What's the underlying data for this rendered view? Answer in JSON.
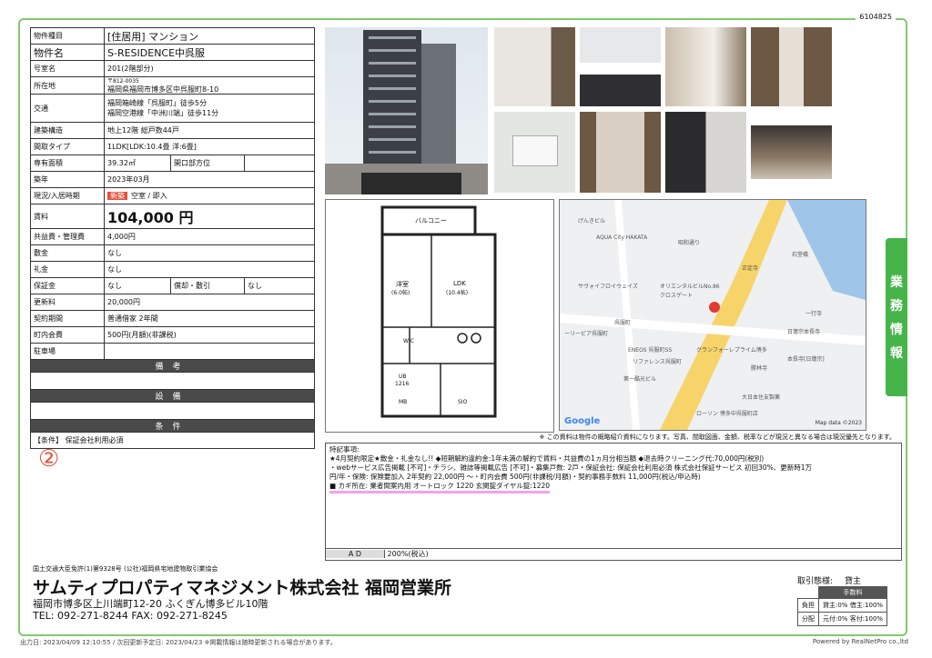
{
  "doc_id": "6104825",
  "info": {
    "type_k": "物件種目",
    "type_v": "[住居用] マンション",
    "name_k": "物件名",
    "name_v": "S-RESIDENCE中呉服",
    "room_k": "号室名",
    "room_v": "201(2階部分)",
    "addr_k": "所在地",
    "zip": "〒812-0035",
    "addr_v": "福岡県福岡市博多区中呉服町8-10",
    "traffic_k": "交通",
    "traffic1": "福岡箱崎線「呉服町」徒歩5分",
    "traffic2": "福岡空港線「中洲川端」徒歩11分",
    "struct_k": "建築構造",
    "struct_v": "地上12階 総戸数44戸",
    "layout_k": "間取タイプ",
    "layout_v": "1LDK[LDK:10.4畳 洋:6畳]",
    "area_k": "専有面積",
    "area_v": "39.32㎡",
    "open_k": "開口部方位",
    "open_v": "",
    "built_k": "築年",
    "built_v": "2023年03月",
    "status_k": "現況/入居時期",
    "status_badge": "新築",
    "status_v": "空室 / 即入",
    "rent_k": "賃料",
    "rent_v": "104,000 円",
    "fee_k": "共益費・管理費",
    "fee_v": "4,000円",
    "deposit_k": "敷金",
    "deposit_v": "なし",
    "key_k": "礼金",
    "key_v": "なし",
    "guar_k": "保証金",
    "guar_v": "なし",
    "amort_k": "償却・敷引",
    "amort_v": "なし",
    "renew_k": "更新料",
    "renew_v": "20,000円",
    "contract_k": "契約期間",
    "contract_v": "普通借家 2年間",
    "town_k": "町内会費",
    "town_v": "500円(月額)(非課税)",
    "parking_k": "駐車場",
    "parking_v": "",
    "remarks_h": "備考",
    "equip_h": "設備",
    "cond_h": "条件",
    "cond_v": "【条件】 保証会社利用必須"
  },
  "floorplan": {
    "balcony": "バルコニー",
    "western": "洋室",
    "western_size": "(6.0帖)",
    "ldk": "LDK",
    "ldk_size": "(10.4帖)",
    "wic": "WIC",
    "ub": "UB",
    "ub_size": "1216",
    "sio": "SIO",
    "mb": "MB"
  },
  "map": {
    "labels": [
      "げんきビル",
      "AQUA City HAKATA",
      "昭和通り",
      "正定寺",
      "石堂橋",
      "サヴォイフロイウェイズ",
      "オリエンタルビルNo.86",
      "クロスゲート",
      "呉服町",
      "一行寺",
      "ーリービア呉服町",
      "ENEOS 呉服町SS",
      "グランフォーレプライム博多",
      "本長寺[日蓮宗]",
      "リファレンス呉服町",
      "勝林寺",
      "第一酷光ビル",
      "大日本住友製薬",
      "ローソン 博多中呉服町店",
      "日蓮宗本長寺"
    ],
    "google": "Google",
    "credit": "Map data ©2023"
  },
  "note_disclaimer": "※ この資料は物件の概略紹介資料になります。写真、間取図面、金額、税率などが現況と異なる場合は現況優先となります。",
  "notes": {
    "title": "特記事項:",
    "line1": "★4月契約限定★敷金・礼金なし!! ◆短期解約違約金:1年未満の解約で賃料・共益費の1ヵ月分相当額 ◆退去時クリーニング代:70,000円(税別)",
    "line2": "・webサービス広告掲載 [不可]・チラシ、雑誌等掲載広告 [不可]・募集戸数: 2戸・保証会社: 保証会社利用必須 株式会社保証サービス 初回30%、更新時1万",
    "line3": "円/年・保険: 保険要加入 2年契約 22,000円 ～・町内会費 500円(非課税/月額)・契約事務手数料 11,000円(税込/申込時)",
    "line4": "■ カギ所在: 業者間案内用 オートロック 1220 玄関錠ダイヤル錠:1220"
  },
  "ad": {
    "label": "A D",
    "value": "200%(税込)"
  },
  "marker": "②",
  "side_tab": [
    "業",
    "務",
    "情",
    "報"
  ],
  "company": {
    "license": "国土交通大臣免許(1)第9328号 (公社)福岡県宅地建物取引業協会",
    "name": "サムティプロパティマネジメント株式会社 福岡営業所",
    "address": "福岡市博多区上川端町12-20 ふくぎん博多ビル10階",
    "phone": "TEL: 092-271-8244 FAX: 092-271-8245"
  },
  "trade": {
    "label": "取引態様:",
    "value": "貸主",
    "fee_h": "手数料",
    "burden_k": "負担",
    "burden_v": "貸主:0% 借主:100%",
    "split_k": "分配",
    "split_v": "元付:0% 客付:100%"
  },
  "footer": {
    "left": "出力日: 2023/04/09 12:10:55 / 次回更新予定日: 2023/04/23 ※掲載情報は随時更新される場合があります。",
    "right": "Powered by RealNetPro co.,ltd"
  }
}
